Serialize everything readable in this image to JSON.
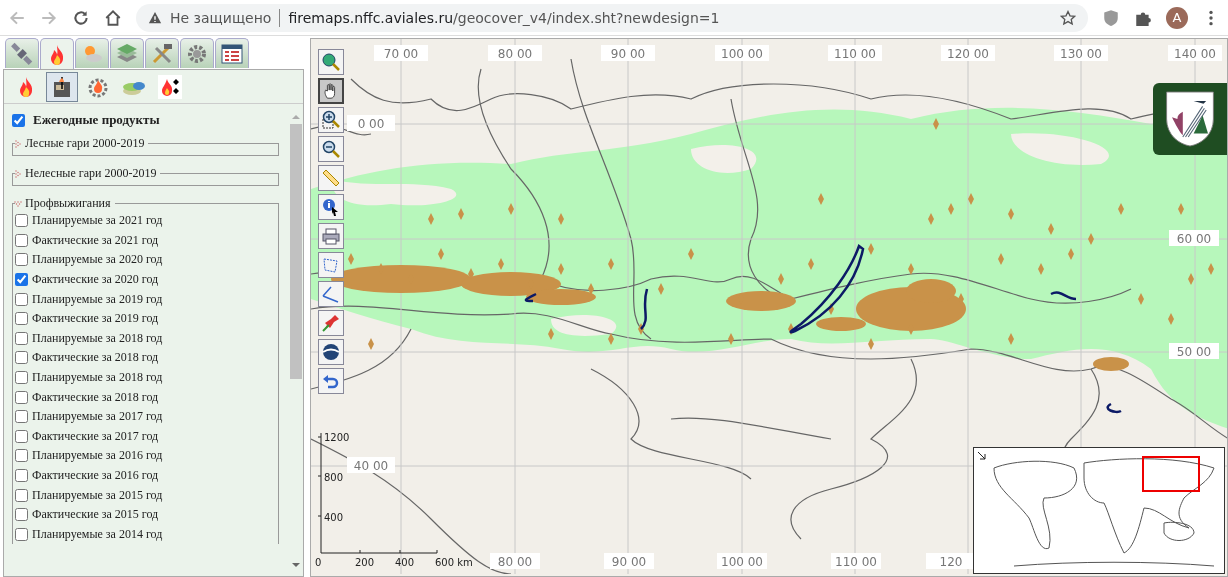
{
  "browser": {
    "security": "Не защищено",
    "url_host": "firemaps.nffc.aviales.ru",
    "url_path": "/geocover_v4/index.sht?newdesign=1",
    "avatar": "A"
  },
  "panel_tabs": [
    {
      "kind": "satellite",
      "selected": false
    },
    {
      "kind": "fire",
      "selected": true
    },
    {
      "kind": "weather",
      "selected": false
    },
    {
      "kind": "layers",
      "selected": false
    },
    {
      "kind": "tools",
      "selected": false
    },
    {
      "kind": "gear",
      "selected": false
    },
    {
      "kind": "table",
      "selected": false
    }
  ],
  "sub_tabs": [
    {
      "kind": "fire",
      "selected": false
    },
    {
      "kind": "archive",
      "selected": true
    },
    {
      "kind": "fire-gear",
      "selected": false
    },
    {
      "kind": "discs",
      "selected": false
    },
    {
      "kind": "fire-dots",
      "selected": false
    }
  ],
  "annual_products": {
    "label": "Ежегодные продукты",
    "checked": true
  },
  "groups": [
    {
      "title": "Лесные гари 2000-2019",
      "expanded": false
    },
    {
      "title": "Нелесные гари 2000-2019",
      "expanded": false
    },
    {
      "title": "Профвыжигания",
      "expanded": true,
      "items": [
        {
          "label": "Планируемые за 2021 год",
          "checked": false
        },
        {
          "label": "Фактические за 2021 год",
          "checked": false
        },
        {
          "label": "Планируемые за 2020 год",
          "checked": false
        },
        {
          "label": "Фактические за 2020 год",
          "checked": true
        },
        {
          "label": "Планируемые за 2019 год",
          "checked": false
        },
        {
          "label": "Фактические за 2019 год",
          "checked": false
        },
        {
          "label": "Планируемые за 2018 год",
          "checked": false
        },
        {
          "label": "Фактические за 2018 год",
          "checked": false
        },
        {
          "label": "Планируемые за 2018 год",
          "checked": false
        },
        {
          "label": "Фактические за 2018 год",
          "checked": false
        },
        {
          "label": "Планируемые за 2017 год",
          "checked": false
        },
        {
          "label": "Фактические за 2017 год",
          "checked": false
        },
        {
          "label": "Планируемые за 2016 год",
          "checked": false
        },
        {
          "label": "Фактические за 2016 год",
          "checked": false
        },
        {
          "label": "Планируемые за 2015 год",
          "checked": false
        },
        {
          "label": "Фактические за 2015 год",
          "checked": false
        },
        {
          "label": "Планируемые за 2014 год",
          "checked": false
        }
      ]
    }
  ],
  "map": {
    "tools": [
      {
        "kind": "globe-search",
        "selected": false
      },
      {
        "kind": "hand",
        "selected": true
      },
      {
        "kind": "zoom-box",
        "selected": false
      },
      {
        "kind": "zoom-out",
        "selected": false
      },
      {
        "kind": "ruler",
        "selected": false
      },
      {
        "kind": "info",
        "selected": false
      },
      {
        "kind": "printer",
        "selected": false
      },
      {
        "kind": "polygon",
        "selected": false
      },
      {
        "kind": "polyline",
        "selected": false
      },
      {
        "kind": "pin",
        "selected": false
      },
      {
        "kind": "globe",
        "selected": false
      },
      {
        "kind": "undo",
        "selected": false
      }
    ],
    "top_labels": [
      "70 00",
      "80 00",
      "90 00",
      "100 00",
      "110 00",
      "120 00",
      "130 00",
      "140 00"
    ],
    "bottom_labels": [
      "80 00",
      "90 00",
      "100 00",
      "110 00",
      "120"
    ],
    "left_labels": [
      "0 00",
      "40 00"
    ],
    "right_labels": [
      "60 00",
      "50 00"
    ],
    "scale_bar": {
      "vertical_ticks": [
        "1200",
        "800",
        "400"
      ],
      "horizontal_ticks": [
        "0",
        "200",
        "400",
        "600 km"
      ]
    }
  }
}
